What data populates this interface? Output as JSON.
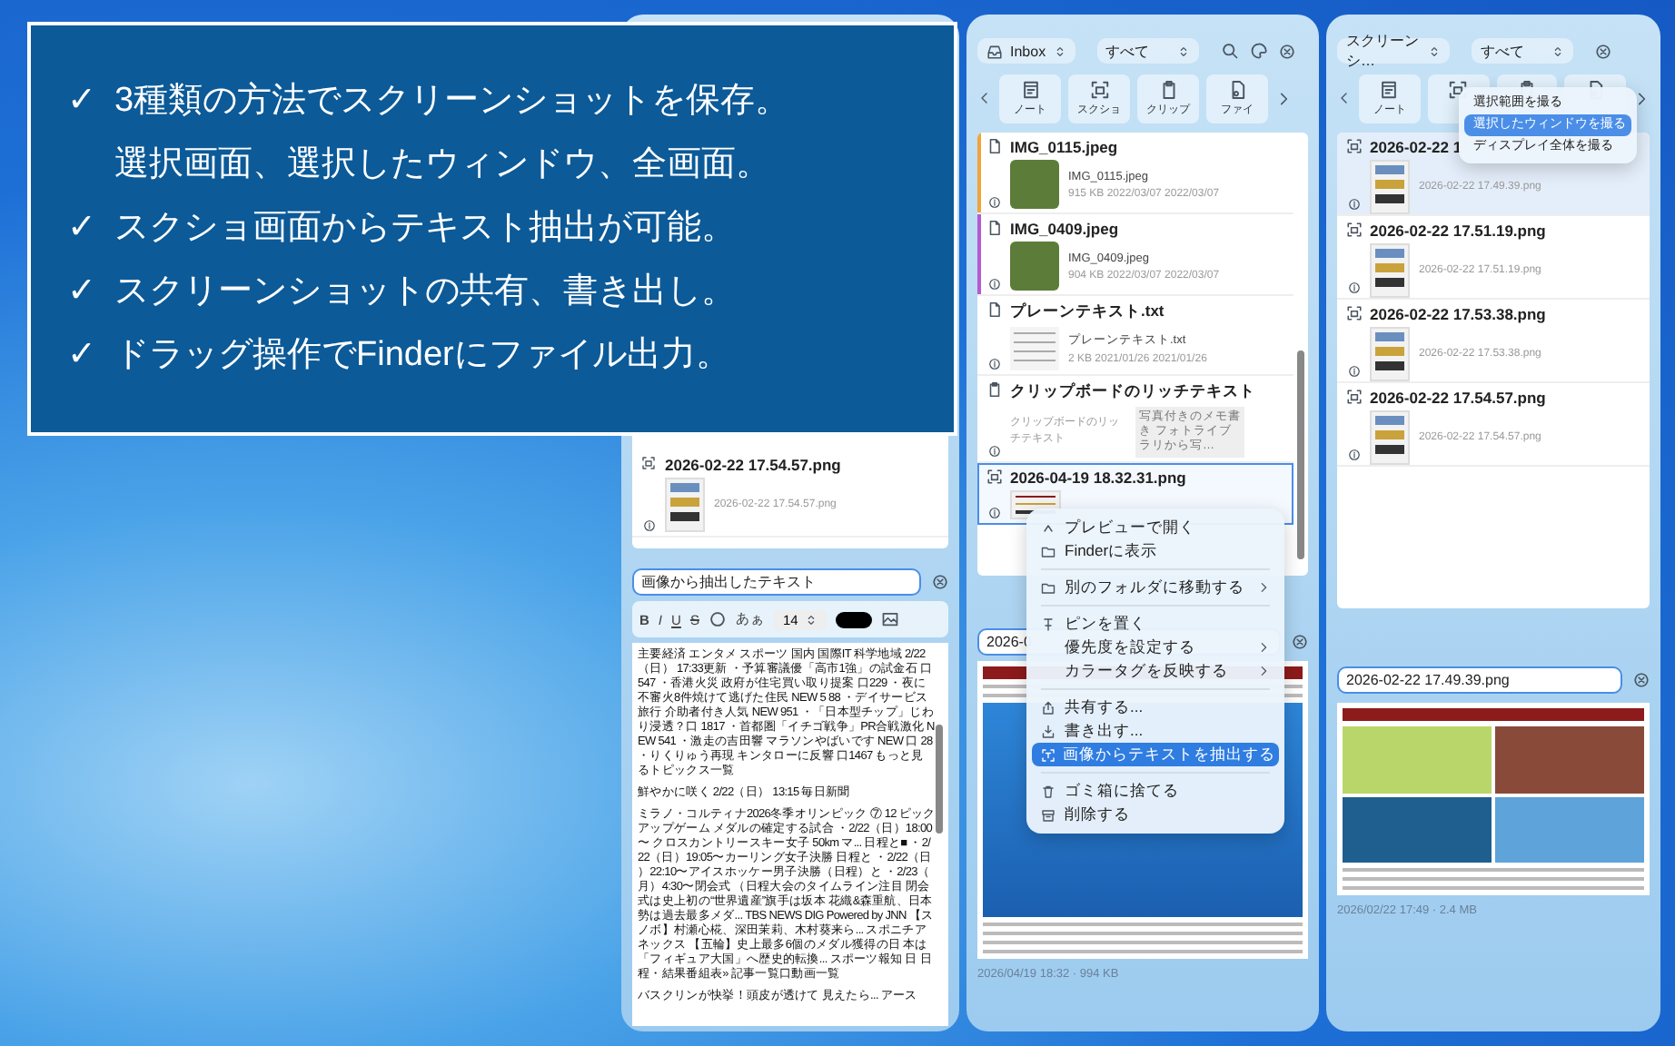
{
  "callout": {
    "mark": "✓",
    "lines": [
      {
        "check": true,
        "text": "3種類の方法でスクリーンショットを保存。"
      },
      {
        "check": false,
        "text": "選択画面、選択したウィンドウ、全画面。"
      },
      {
        "check": true,
        "text": "スクショ画面からテキスト抽出が可能。"
      },
      {
        "check": true,
        "text": "スクリーンショットの共有、書き出し。"
      },
      {
        "check": true,
        "text": "ドラッグ操作でFinderにファイル出力。"
      }
    ]
  },
  "left_panel": {
    "items": [
      {
        "name": "2026-02-22 17.54.57.png",
        "subtitle": "2026-02-22 17.54.57.png"
      }
    ],
    "title_field": {
      "value": "画像から抽出したテキスト"
    },
    "format_toolbar": {
      "bold": "B",
      "italic": "I",
      "underline": "U",
      "strike": "S",
      "kana": "あぁ",
      "font_size": "14"
    },
    "extracted_text": [
      "主要経済 エンタメ スポーツ 国内 国際IT 科学地域 2/22（日） 17:33更新 ・予算審議優「高市1強」の試金石 口547 ・香港火災 政府が住宅買い取り提案 口229 ・夜に不審火8件焼けて逃げた住民 NEW 5 88 ・デイサービス旅行 介助者付き人気 NEW 951 ・「日本型チップ」じわり浸透？口 1817 ・首都圏「イチゴ戦争」PR合戦激化 NEW 541 ・激走の吉田響 マラソンやばいです NEW 口 28 ・りくりゅう再現 キンタローに反響 口1467 もっと見るトピックス一覧",
      "鮮やかに咲く 2/22（日） 13:15 毎日新聞",
      "ミラノ・コルティナ2026冬季オリンピック ⑦ 12 ピックアップゲーム メダルの確定する試合 ・2/22（日）18:00〜 クロスカントリースキー女子 50km マ... 日程と■ ・2/22（日）19:05〜カーリング女子決勝 日程と ・2/22（日）22:10〜アイスホッケー男子決勝（日程）と ・2/23（月）4:30〜閉会式 （日程大会のタイムライン注目 閉会式は史上初の“世界遺産”旗手は坂本 花織&森重航、日本勢は過去最多メダ... TBS NEWS DIG Powered by JNN 【スノボ】村瀬心椛、深田茉莉、木村葵来ら... スポニチアネックス 【五輪】史上最多6個のメダル獲得の日 本は「フィギュア大国」へ歴史的転換... スポーツ報知 日 日程・結果番組表» 記事一覧口動画一覧",
      "バスクリンが快挙！頭皮が透けて 見えたら... アース"
    ]
  },
  "middle_panel": {
    "folder": "Inbox",
    "filter": "すべて",
    "categories": [
      {
        "kind": "note",
        "label": "ノート"
      },
      {
        "kind": "screenshot",
        "label": "スクショ"
      },
      {
        "kind": "clip",
        "label": "クリップ"
      },
      {
        "kind": "file",
        "label": "ファイ"
      }
    ],
    "items": [
      {
        "kind": "image",
        "name": "IMG_0115.jpeg",
        "file": "IMG_0115.jpeg",
        "meta": "915 KB   2022/03/07   2022/03/07",
        "color": "#f0a43a",
        "selected": false
      },
      {
        "kind": "image",
        "name": "IMG_0409.jpeg",
        "file": "IMG_0409.jpeg",
        "meta": "904 KB   2022/03/07   2022/03/07",
        "color": "#b45ad2",
        "selected": false
      },
      {
        "kind": "text",
        "name": "プレーンテキスト.txt",
        "file": "プレーンテキスト.txt",
        "meta": "2 KB   2021/01/26   2021/01/26",
        "selected": false
      },
      {
        "kind": "rich",
        "name": "クリップボードのリッチテキスト",
        "file": "クリップボードのリッチテキスト",
        "note": "写真付きのメモ書き フォトライブラリから写…",
        "selected": false
      },
      {
        "kind": "screenshot",
        "name": "2026-04-19 18.32.31.png",
        "selected": true
      }
    ],
    "title_field": {
      "value": "2026-0"
    },
    "caption": "2026/04/19 18:32 · 994 KB",
    "context_menu": [
      {
        "kind": "item",
        "label": "プレビューで開く",
        "submenu": false,
        "selected": false
      },
      {
        "kind": "item",
        "label": "Finderに表示",
        "submenu": false,
        "selected": false
      },
      {
        "kind": "separator"
      },
      {
        "kind": "item",
        "label": "別のフォルダに移動する",
        "submenu": true,
        "selected": false
      },
      {
        "kind": "separator"
      },
      {
        "kind": "item",
        "label": "ピンを置く",
        "submenu": false,
        "selected": false
      },
      {
        "kind": "item",
        "label": "優先度を設定する",
        "submenu": true,
        "selected": false
      },
      {
        "kind": "item",
        "label": "カラータグを反映する",
        "submenu": true,
        "selected": false
      },
      {
        "kind": "separator"
      },
      {
        "kind": "item",
        "label": "共有する...",
        "submenu": false,
        "selected": false
      },
      {
        "kind": "item",
        "label": "書き出す...",
        "submenu": false,
        "selected": false
      },
      {
        "kind": "item",
        "label": "画像からテキストを抽出する",
        "submenu": false,
        "selected": true
      },
      {
        "kind": "separator"
      },
      {
        "kind": "item",
        "label": "ゴミ箱に捨てる",
        "submenu": false,
        "selected": false
      },
      {
        "kind": "item",
        "label": "削除する",
        "submenu": false,
        "selected": false
      }
    ]
  },
  "right_panel": {
    "folder": "スクリーンシ…",
    "filter": "すべて",
    "categories": [
      {
        "kind": "note",
        "label": "ノート"
      },
      {
        "kind": "screenshot"
      },
      {
        "kind": "clip"
      },
      {
        "kind": "file"
      }
    ],
    "dropdown": [
      {
        "label": "選択範囲を撮る",
        "selected": false
      },
      {
        "label": "選択したウィンドウを撮る",
        "selected": true
      },
      {
        "label": "ディスプレイ全体を撮る",
        "selected": false
      }
    ],
    "items": [
      {
        "name": "2026-02-22 1",
        "subtitle": "2026-02-22 17.49.39.png",
        "selected": true
      },
      {
        "name": "2026-02-22 17.51.19.png",
        "subtitle": "2026-02-22 17.51.19.png",
        "selected": false
      },
      {
        "name": "2026-02-22 17.53.38.png",
        "subtitle": "2026-02-22 17.53.38.png",
        "selected": false
      },
      {
        "name": "2026-02-22 17.54.57.png",
        "subtitle": "2026-02-22 17.54.57.png",
        "selected": false
      }
    ],
    "title_field": {
      "value": "2026-02-22 17.49.39.png"
    },
    "caption": "2026/02/22 17:49 · 2.4 MB"
  }
}
